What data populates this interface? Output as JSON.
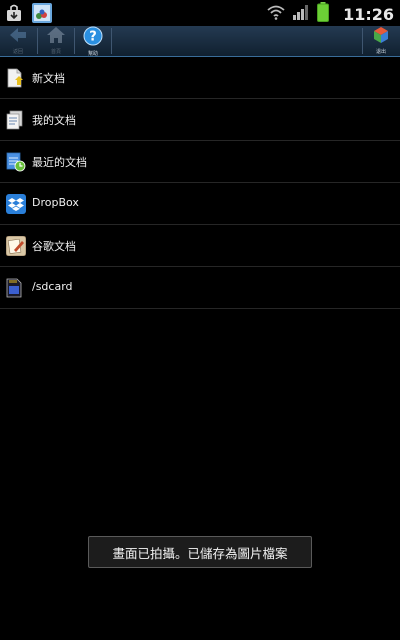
{
  "status_bar": {
    "time": "11:26",
    "icons": [
      "download-notification-icon",
      "gallery-notification-icon",
      "wifi-icon",
      "signal-icon",
      "battery-icon"
    ]
  },
  "action_bar": {
    "back_label": "返回",
    "home_label": "首頁",
    "help_label": "幫助",
    "exit_label": "退出"
  },
  "file_list": {
    "items": [
      {
        "label": "新文档",
        "icon": "new-document-icon"
      },
      {
        "label": "我的文档",
        "icon": "my-documents-icon"
      },
      {
        "label": "最近的文档",
        "icon": "recent-documents-icon"
      },
      {
        "label": "DropBox",
        "icon": "dropbox-icon"
      },
      {
        "label": "谷歌文档",
        "icon": "google-docs-icon"
      },
      {
        "label": "/sdcard",
        "icon": "sdcard-icon"
      }
    ]
  },
  "toast": {
    "message": "畫面已拍攝。已儲存為圖片檔案"
  },
  "colors": {
    "background": "#000000",
    "action_bar": "#1a2d42",
    "accent": "#3a6d99"
  }
}
